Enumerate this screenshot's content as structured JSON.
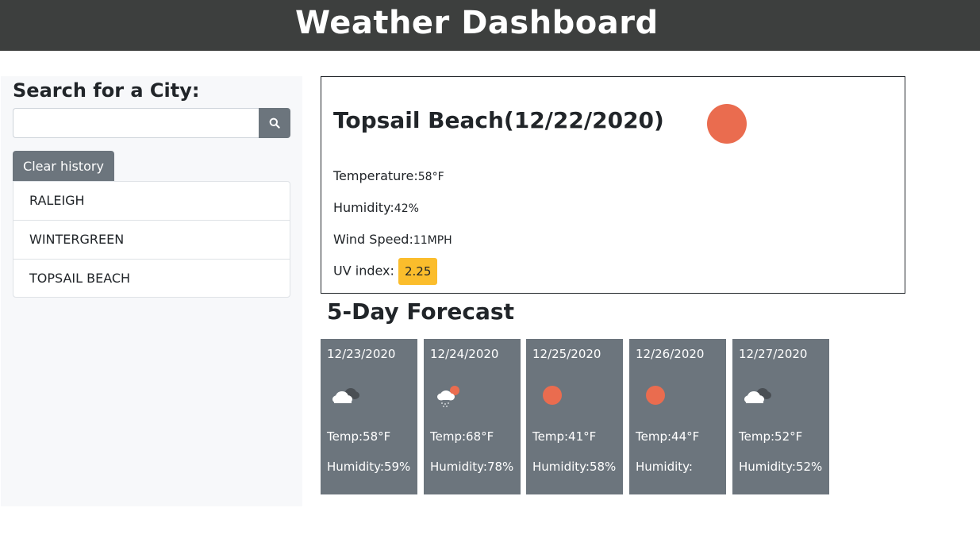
{
  "header": {
    "title": "Weather Dashboard"
  },
  "sidebar": {
    "heading": "Search for a City:",
    "search": {
      "value": "",
      "placeholder": "",
      "button_icon": "search-icon"
    },
    "clear_label": "Clear history",
    "history": [
      "RALEIGH",
      "WINTERGREEN",
      "TOPSAIL BEACH"
    ]
  },
  "current": {
    "title": "Topsail Beach(12/22/2020)",
    "icon": "sun-icon",
    "temperature_label": "Temperature:",
    "temperature_value": "58°F",
    "humidity_label": "Humidity:",
    "humidity_value": "42%",
    "wind_label": "Wind Speed:",
    "wind_value": "11MPH",
    "uv_label": "UV index:",
    "uv_value": "2.25",
    "uv_color": "#fbbd2c"
  },
  "forecast": {
    "heading": "5-Day Forecast",
    "days": [
      {
        "date": "12/23/2020",
        "icon": "cloudy-icon",
        "temp": "Temp:58°F",
        "humidity": "Humidity:59%"
      },
      {
        "date": "12/24/2020",
        "icon": "rain-icon",
        "temp": "Temp:68°F",
        "humidity": "Humidity:78%"
      },
      {
        "date": "12/25/2020",
        "icon": "sun-icon",
        "temp": "Temp:41°F",
        "humidity": "Humidity:58%"
      },
      {
        "date": "12/26/2020",
        "icon": "sun-icon",
        "temp": "Temp:44°F",
        "humidity": "Humidity:"
      },
      {
        "date": "12/27/2020",
        "icon": "cloudy-icon",
        "temp": "Temp:52°F",
        "humidity": "Humidity:52%"
      }
    ]
  },
  "colors": {
    "header_bg": "#3d3f3e",
    "card_bg": "#6c757d",
    "sun": "#ea6c4f",
    "uv": "#fbbd2c"
  }
}
